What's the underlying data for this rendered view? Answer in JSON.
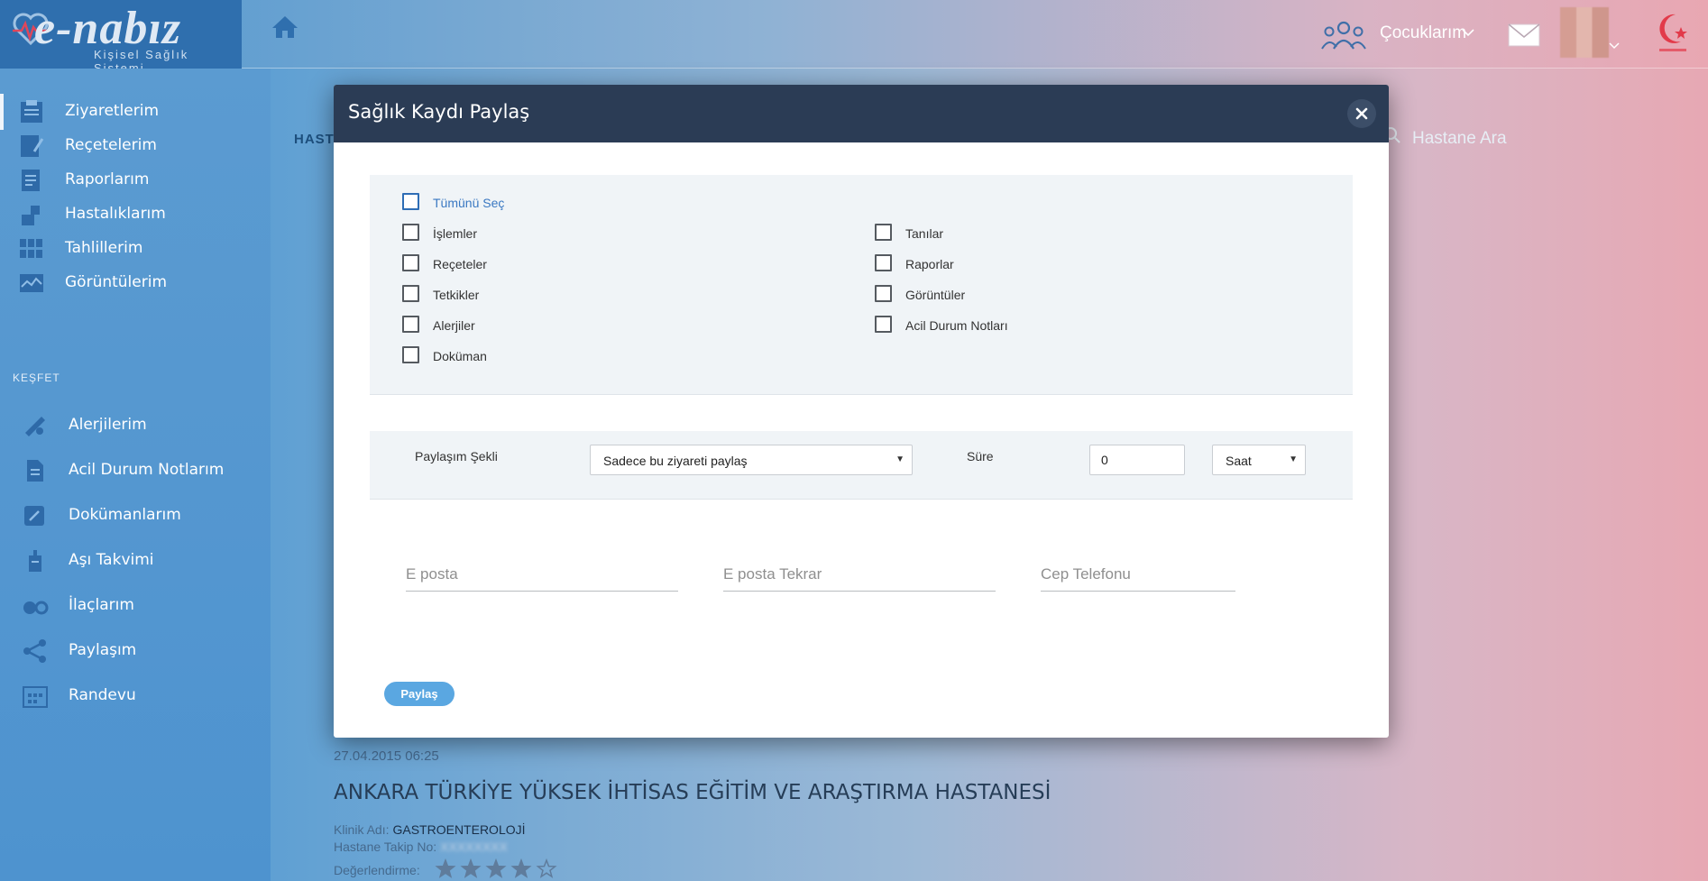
{
  "header": {
    "logo_title": "e-nabız",
    "logo_subtitle": "Kişisel Sağlık Sistemi",
    "children_label": "Çocuklarım"
  },
  "sidebar": {
    "items": [
      {
        "label": "Ziyaretlerim",
        "icon": "clipboard-icon"
      },
      {
        "label": "Reçetelerim",
        "icon": "prescription-icon"
      },
      {
        "label": "Raporlarım",
        "icon": "report-icon"
      },
      {
        "label": "Hastalıklarım",
        "icon": "puzzle-icon"
      },
      {
        "label": "Tahlillerim",
        "icon": "grid-icon"
      },
      {
        "label": "Görüntülerim",
        "icon": "image-icon"
      }
    ],
    "explore_heading": "KEŞFET",
    "explore_items": [
      {
        "label": "Alerjilerim",
        "icon": "allergy-icon"
      },
      {
        "label": "Acil Durum Notlarım",
        "icon": "notes-icon"
      },
      {
        "label": "Dokümanlarım",
        "icon": "document-icon"
      },
      {
        "label": "Aşı Takvimi",
        "icon": "vaccine-icon"
      },
      {
        "label": "İlaçlarım",
        "icon": "pills-icon"
      },
      {
        "label": "Paylaşım",
        "icon": "share-icon"
      },
      {
        "label": "Randevu",
        "icon": "calendar-icon"
      }
    ]
  },
  "main": {
    "tab_label": "HASTA",
    "hospital_search_label": "Hastane Ara",
    "visit_date": "27.04.2015 06:25",
    "hospital_name": "ANKARA TÜRKİYE YÜKSEK İHTİSAS EĞİTİM VE ARAŞTIRMA HASTANESİ",
    "clinic_label": "Klinik Adı:",
    "clinic_value": "GASTROENTEROLOJİ",
    "tracking_label": "Hastane Takip No:",
    "tracking_value": "XXXXXXXX",
    "rating_label": "Değerlendirme:",
    "rating": {
      "value": 4,
      "max": 5
    }
  },
  "modal": {
    "title": "Sağlık Kaydı Paylaş",
    "select_all": "Tümünü Seç",
    "checkboxes_left": [
      "İşlemler",
      "Reçeteler",
      "Tetkikler",
      "Alerjiler",
      "Doküman"
    ],
    "checkboxes_right": [
      "Tanılar",
      "Raporlar",
      "Görüntüler",
      "Acil Durum Notları"
    ],
    "share_type_label": "Paylaşım Şekli",
    "share_type_value": "Sadece bu ziyareti paylaş",
    "duration_label": "Süre",
    "duration_value": "0",
    "duration_unit": "Saat",
    "email_placeholder": "E posta",
    "email_repeat_placeholder": "E posta Tekrar",
    "phone_placeholder": "Cep Telefonu",
    "share_button": "Paylaş"
  },
  "colors": {
    "modal_header": "#2b3c55",
    "share_button": "#5aa7e1",
    "select_all_text": "#3a78c2",
    "panel_bg": "#f0f4f7"
  }
}
